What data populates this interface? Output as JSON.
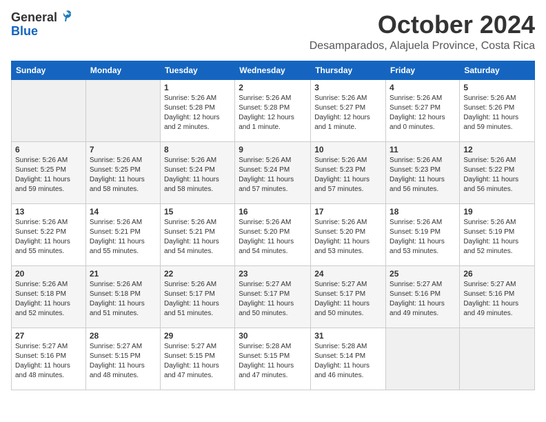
{
  "logo": {
    "general": "General",
    "blue": "Blue"
  },
  "title": "October 2024",
  "subtitle": "Desamparados, Alajuela Province, Costa Rica",
  "days_header": [
    "Sunday",
    "Monday",
    "Tuesday",
    "Wednesday",
    "Thursday",
    "Friday",
    "Saturday"
  ],
  "weeks": [
    [
      {
        "day": "",
        "info": ""
      },
      {
        "day": "",
        "info": ""
      },
      {
        "day": "1",
        "info": "Sunrise: 5:26 AM\nSunset: 5:28 PM\nDaylight: 12 hours\nand 2 minutes."
      },
      {
        "day": "2",
        "info": "Sunrise: 5:26 AM\nSunset: 5:28 PM\nDaylight: 12 hours\nand 1 minute."
      },
      {
        "day": "3",
        "info": "Sunrise: 5:26 AM\nSunset: 5:27 PM\nDaylight: 12 hours\nand 1 minute."
      },
      {
        "day": "4",
        "info": "Sunrise: 5:26 AM\nSunset: 5:27 PM\nDaylight: 12 hours\nand 0 minutes."
      },
      {
        "day": "5",
        "info": "Sunrise: 5:26 AM\nSunset: 5:26 PM\nDaylight: 11 hours\nand 59 minutes."
      }
    ],
    [
      {
        "day": "6",
        "info": "Sunrise: 5:26 AM\nSunset: 5:25 PM\nDaylight: 11 hours\nand 59 minutes."
      },
      {
        "day": "7",
        "info": "Sunrise: 5:26 AM\nSunset: 5:25 PM\nDaylight: 11 hours\nand 58 minutes."
      },
      {
        "day": "8",
        "info": "Sunrise: 5:26 AM\nSunset: 5:24 PM\nDaylight: 11 hours\nand 58 minutes."
      },
      {
        "day": "9",
        "info": "Sunrise: 5:26 AM\nSunset: 5:24 PM\nDaylight: 11 hours\nand 57 minutes."
      },
      {
        "day": "10",
        "info": "Sunrise: 5:26 AM\nSunset: 5:23 PM\nDaylight: 11 hours\nand 57 minutes."
      },
      {
        "day": "11",
        "info": "Sunrise: 5:26 AM\nSunset: 5:23 PM\nDaylight: 11 hours\nand 56 minutes."
      },
      {
        "day": "12",
        "info": "Sunrise: 5:26 AM\nSunset: 5:22 PM\nDaylight: 11 hours\nand 56 minutes."
      }
    ],
    [
      {
        "day": "13",
        "info": "Sunrise: 5:26 AM\nSunset: 5:22 PM\nDaylight: 11 hours\nand 55 minutes."
      },
      {
        "day": "14",
        "info": "Sunrise: 5:26 AM\nSunset: 5:21 PM\nDaylight: 11 hours\nand 55 minutes."
      },
      {
        "day": "15",
        "info": "Sunrise: 5:26 AM\nSunset: 5:21 PM\nDaylight: 11 hours\nand 54 minutes."
      },
      {
        "day": "16",
        "info": "Sunrise: 5:26 AM\nSunset: 5:20 PM\nDaylight: 11 hours\nand 54 minutes."
      },
      {
        "day": "17",
        "info": "Sunrise: 5:26 AM\nSunset: 5:20 PM\nDaylight: 11 hours\nand 53 minutes."
      },
      {
        "day": "18",
        "info": "Sunrise: 5:26 AM\nSunset: 5:19 PM\nDaylight: 11 hours\nand 53 minutes."
      },
      {
        "day": "19",
        "info": "Sunrise: 5:26 AM\nSunset: 5:19 PM\nDaylight: 11 hours\nand 52 minutes."
      }
    ],
    [
      {
        "day": "20",
        "info": "Sunrise: 5:26 AM\nSunset: 5:18 PM\nDaylight: 11 hours\nand 52 minutes."
      },
      {
        "day": "21",
        "info": "Sunrise: 5:26 AM\nSunset: 5:18 PM\nDaylight: 11 hours\nand 51 minutes."
      },
      {
        "day": "22",
        "info": "Sunrise: 5:26 AM\nSunset: 5:17 PM\nDaylight: 11 hours\nand 51 minutes."
      },
      {
        "day": "23",
        "info": "Sunrise: 5:27 AM\nSunset: 5:17 PM\nDaylight: 11 hours\nand 50 minutes."
      },
      {
        "day": "24",
        "info": "Sunrise: 5:27 AM\nSunset: 5:17 PM\nDaylight: 11 hours\nand 50 minutes."
      },
      {
        "day": "25",
        "info": "Sunrise: 5:27 AM\nSunset: 5:16 PM\nDaylight: 11 hours\nand 49 minutes."
      },
      {
        "day": "26",
        "info": "Sunrise: 5:27 AM\nSunset: 5:16 PM\nDaylight: 11 hours\nand 49 minutes."
      }
    ],
    [
      {
        "day": "27",
        "info": "Sunrise: 5:27 AM\nSunset: 5:16 PM\nDaylight: 11 hours\nand 48 minutes."
      },
      {
        "day": "28",
        "info": "Sunrise: 5:27 AM\nSunset: 5:15 PM\nDaylight: 11 hours\nand 48 minutes."
      },
      {
        "day": "29",
        "info": "Sunrise: 5:27 AM\nSunset: 5:15 PM\nDaylight: 11 hours\nand 47 minutes."
      },
      {
        "day": "30",
        "info": "Sunrise: 5:28 AM\nSunset: 5:15 PM\nDaylight: 11 hours\nand 47 minutes."
      },
      {
        "day": "31",
        "info": "Sunrise: 5:28 AM\nSunset: 5:14 PM\nDaylight: 11 hours\nand 46 minutes."
      },
      {
        "day": "",
        "info": ""
      },
      {
        "day": "",
        "info": ""
      }
    ]
  ]
}
